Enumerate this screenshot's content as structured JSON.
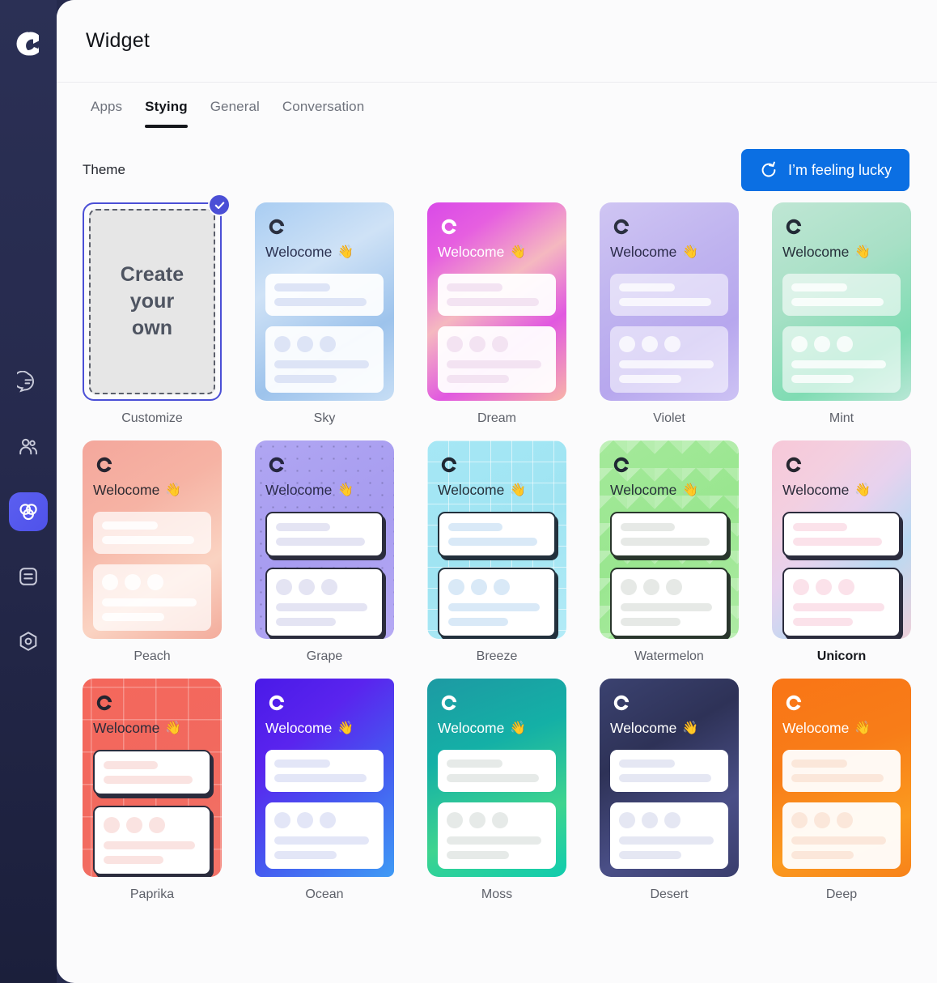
{
  "app": {
    "logo_icon": "chat-c-logo",
    "sidebar_items": [
      {
        "icon": "chat-bubble-icon",
        "name": "conversations",
        "active": false
      },
      {
        "icon": "users-icon",
        "name": "contacts",
        "active": false
      },
      {
        "icon": "widget-rings-icon",
        "name": "widget",
        "active": true
      },
      {
        "icon": "document-icon",
        "name": "knowledge",
        "active": false
      },
      {
        "icon": "hexagon-settings-icon",
        "name": "settings",
        "active": false
      }
    ]
  },
  "header": {
    "title": "Widget"
  },
  "tabs": [
    {
      "label": "Apps",
      "active": false
    },
    {
      "label": "Stying",
      "active": true
    },
    {
      "label": "General",
      "active": false
    },
    {
      "label": "Conversation",
      "active": false
    }
  ],
  "section": {
    "theme_label": "Theme",
    "lucky_button_label": "I’m feeling lucky",
    "lucky_button_icon": "refresh-icon",
    "lucky_button_color": "#0b6fe3",
    "selected_badge_icon": "check-icon",
    "selected_badge_color": "#4b4fd6"
  },
  "customize_card": {
    "name": "Customize",
    "text_line1": "Create",
    "text_line2": "your",
    "text_line3": "own",
    "selected": true
  },
  "preview": {
    "welcome_text": "Welocome",
    "wave_emoji": "👋",
    "logo_glyph": "C"
  },
  "themes": [
    {
      "name": "Sky",
      "background": "linear-gradient(150deg,#a9cdf2 0%,#cfe2f6 35%,#9dc3ec 70%,#c7def5 100%)",
      "text_color": "#2b3150",
      "logo_color": "#2b3040",
      "bubble_bg": "rgba(255,255,255,0.92)",
      "bubble_line": "#dde4f6",
      "bubble_border": "none",
      "bubble_shadow": "none",
      "pattern": "none",
      "radius": "14px",
      "label_highlight": false
    },
    {
      "name": "Dream",
      "background": "linear-gradient(145deg,#d94ae8 0%,#e65fe0 20%,#f5b8c0 45%,#e158e0 70%,#f8b4a8 100%)",
      "text_color": "#ffffff",
      "logo_color": "#ffffff",
      "bubble_bg": "rgba(255,255,255,0.95)",
      "bubble_line": "#f3e3f2",
      "bubble_border": "none",
      "bubble_shadow": "none",
      "pattern": "none",
      "radius": "14px",
      "label_highlight": false
    },
    {
      "name": "Violet",
      "background": "linear-gradient(150deg,#cfc5f3 0%,#bfb3ef 40%,#b7a7ee 70%,#cdc3f4 100%)",
      "text_color": "#2b2b4a",
      "logo_color": "#2b3040",
      "bubble_bg": "rgba(255,255,255,0.55)",
      "bubble_line": "rgba(255,255,255,0.75)",
      "bubble_border": "none",
      "bubble_shadow": "none",
      "pattern": "none",
      "radius": "14px",
      "label_highlight": false
    },
    {
      "name": "Mint",
      "background": "linear-gradient(150deg,#bfe6d4 0%,#a8e0c6 40%,#7fdcb3 75%,#b9e7d6 100%)",
      "text_color": "#26303a",
      "logo_color": "#222a36",
      "bubble_bg": "rgba(255,255,255,0.6)",
      "bubble_line": "rgba(255,255,255,0.8)",
      "bubble_border": "none",
      "bubble_shadow": "none",
      "pattern": "none",
      "radius": "14px",
      "label_highlight": false
    },
    {
      "name": "Peach",
      "background": "linear-gradient(150deg,#f4a79c 0%,#f6b3a4 35%,#fad3c2 70%,#f3ac9c 100%)",
      "text_color": "#2e2a30",
      "logo_color": "#262430",
      "bubble_bg": "rgba(255,255,255,0.72)",
      "bubble_line": "rgba(255,255,255,0.85)",
      "bubble_border": "none",
      "bubble_shadow": "none",
      "pattern": "none",
      "radius": "14px",
      "label_highlight": false
    },
    {
      "name": "Grape",
      "background": "linear-gradient(150deg,#b0a6f2 0%,#a79cf0 50%,#b6aaf4 100%)",
      "text_color": "#2b2b4a",
      "logo_color": "#262640",
      "bubble_bg": "#ffffff",
      "bubble_line": "#e4e4f3",
      "bubble_border": "2px solid #2b2c3d",
      "bubble_shadow": "3px 4px 0 #2b2c3d",
      "pattern": "dots",
      "radius": "14px",
      "label_highlight": false
    },
    {
      "name": "Breeze",
      "background": "linear-gradient(150deg,#a6e7f5 0%,#9fe4f2 50%,#b3ebf7 100%)",
      "text_color": "#26303a",
      "logo_color": "#1f2833",
      "bubble_bg": "#ffffff",
      "bubble_line": "#d9e9f7",
      "bubble_border": "2px solid #22303c",
      "bubble_shadow": "3px 4px 0 #22303c",
      "pattern": "grid",
      "radius": "14px",
      "label_highlight": false
    },
    {
      "name": "Watermelon",
      "background": "linear-gradient(150deg,#a4e99a 0%,#99e68f 50%,#aeeba4 100%)",
      "text_color": "#26303a",
      "logo_color": "#1f2833",
      "bubble_bg": "#ffffff",
      "bubble_line": "#e6e9e6",
      "bubble_border": "2px solid #29362c",
      "bubble_shadow": "3px 4px 0 #29362c",
      "pattern": "triangles",
      "radius": "14px",
      "label_highlight": false
    },
    {
      "name": "Unicorn",
      "background": "linear-gradient(135deg,#f7c8d8 0%,#f3cfe0 25%,#e7d2ee 45%,#b9d9f2 70%,#efd0da 100%)",
      "text_color": "#2b2b3a",
      "logo_color": "#26262f",
      "bubble_bg": "#ffffff",
      "bubble_line": "#fbe2ea",
      "bubble_border": "2px solid #2b2c3d",
      "bubble_shadow": "3px 4px 0 #2b2c3d",
      "pattern": "none",
      "radius": "14px",
      "label_highlight": true
    },
    {
      "name": "Paprika",
      "background": "linear-gradient(150deg,#f4675c 0%,#f2695e 50%,#f37368 100%)",
      "text_color": "#2b2b3a",
      "logo_color": "#24242f",
      "bubble_bg": "#ffffff",
      "bubble_line": "#fae3e1",
      "bubble_border": "2px solid #2b2c3d",
      "bubble_shadow": "3px 4px 0 #2b2c3d",
      "pattern": "plus",
      "radius": "14px",
      "label_highlight": false
    },
    {
      "name": "Ocean",
      "background": "linear-gradient(140deg,#4a1ae8 0%,#5a24ee 30%,#4656f0 60%,#3f9bf5 100%)",
      "text_color": "#ffffff",
      "logo_color": "#ffffff",
      "bubble_bg": "#ffffff",
      "bubble_line": "#e3e6f7",
      "bubble_border": "none",
      "bubble_shadow": "none",
      "pattern": "none",
      "radius": "8px",
      "label_highlight": false
    },
    {
      "name": "Moss",
      "background": "linear-gradient(160deg,#1d9aa3 0%,#14b0a6 35%,#3ed48f 70%,#10ccae 100%)",
      "text_color": "#ffffff",
      "logo_color": "#ffffff",
      "bubble_bg": "#ffffff",
      "bubble_line": "#e6eae8",
      "bubble_border": "none",
      "bubble_shadow": "none",
      "pattern": "none",
      "radius": "14px",
      "label_highlight": false
    },
    {
      "name": "Desert",
      "background": "linear-gradient(150deg,#3b4270 0%,#2e3257 35%,#4a4f87 70%,#3a3e6d 100%)",
      "text_color": "#ffffff",
      "logo_color": "#ffffff",
      "bubble_bg": "#ffffff",
      "bubble_line": "#e5e7f3",
      "bubble_border": "none",
      "bubble_shadow": "none",
      "pattern": "none",
      "radius": "14px",
      "label_highlight": false
    },
    {
      "name": "Deep",
      "background": "linear-gradient(160deg,#f97516 0%,#f87d18 40%,#fb9a1f 75%,#f7821a 100%)",
      "text_color": "#ffffff",
      "logo_color": "#ffffff",
      "bubble_bg": "rgba(255,255,255,0.95)",
      "bubble_line": "#fbe7da",
      "bubble_border": "none",
      "bubble_shadow": "none",
      "pattern": "none",
      "radius": "14px",
      "label_highlight": false
    }
  ]
}
